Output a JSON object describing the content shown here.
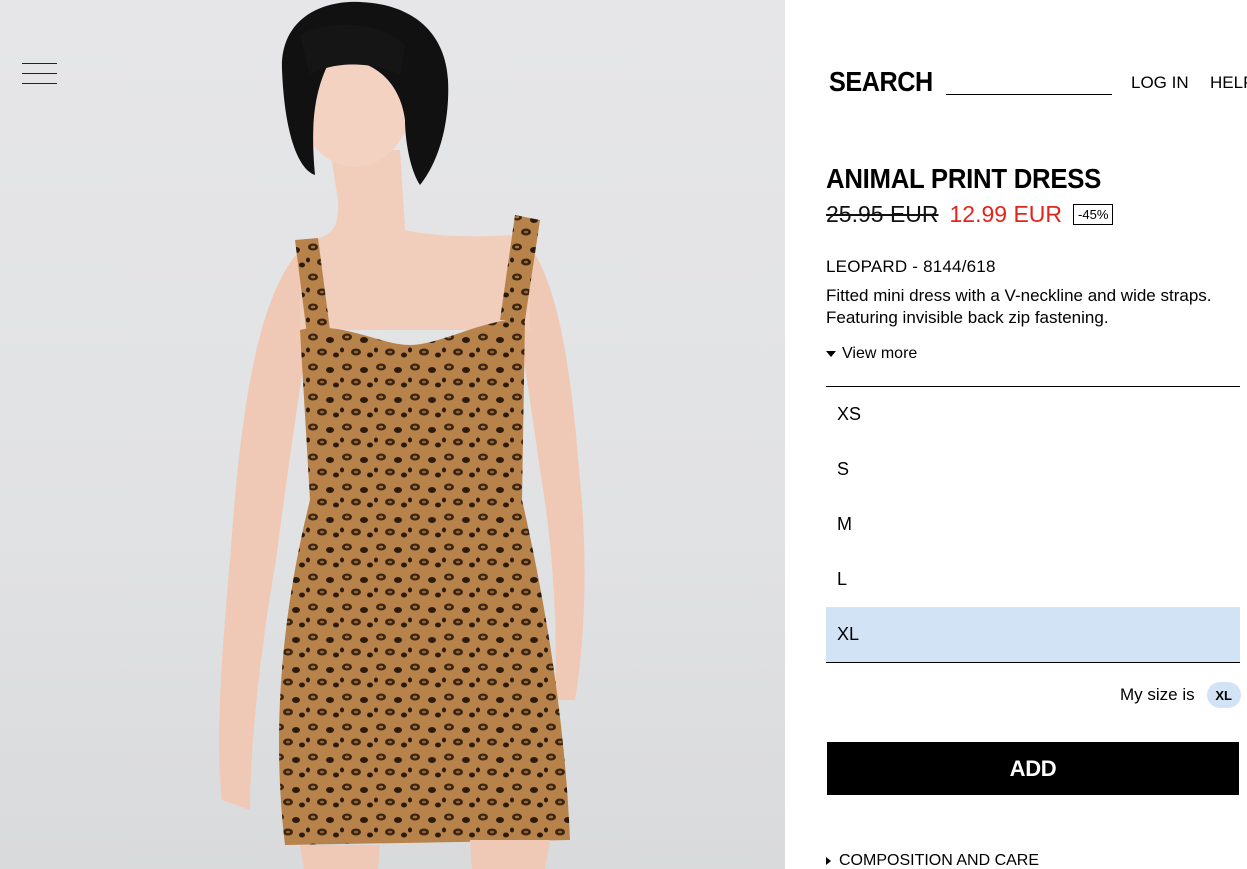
{
  "header": {
    "menu_icon": "hamburger-menu-icon",
    "search_label": "SEARCH",
    "search_value": "",
    "nav": [
      "LOG IN",
      "HELP"
    ]
  },
  "product": {
    "image_icon": "product-photo",
    "title": "ANIMAL PRINT DRESS",
    "old_price": "25.95 EUR",
    "new_price": "12.99 EUR",
    "discount": "-45%",
    "color_ref": "LEOPARD - 8144/618",
    "description": "Fitted mini dress with a V-neckline and wide straps. Featuring invisible back zip fastening.",
    "view_more": "View more"
  },
  "sizes": {
    "options": [
      "XS",
      "S",
      "M",
      "L",
      "XL"
    ],
    "selected": "XL"
  },
  "my_size": {
    "label": "My size is",
    "value": "XL"
  },
  "actions": {
    "add_label": "ADD",
    "composition_label": "COMPOSITION AND CARE"
  },
  "colors": {
    "accent_red": "#e3241b",
    "selected_bg": "#d3e3f6",
    "button_bg": "#000000"
  }
}
